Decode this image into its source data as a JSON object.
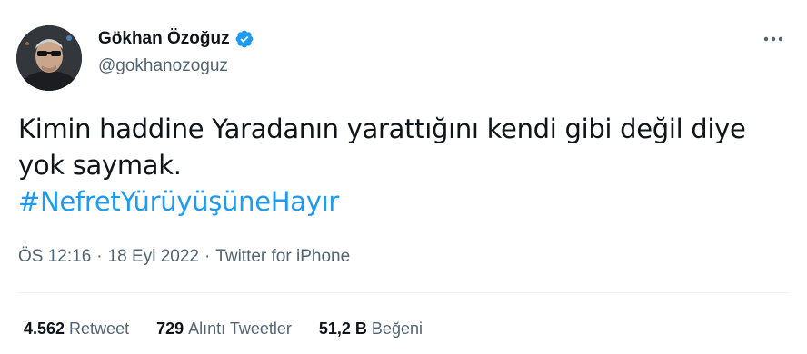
{
  "user": {
    "display_name": "Gökhan Özoğuz",
    "handle": "@gokhanozoguz",
    "verified": true,
    "avatar_icon": "profile-photo"
  },
  "tweet": {
    "lines": [
      "Kimin haddine Yaradanın yarattığını kendi gibi değil diye",
      "yok saymak."
    ],
    "hashtag": "#NefretYürüyüşüneHayır"
  },
  "meta": {
    "time": "ÖS 12:16",
    "separator": "·",
    "date": "18 Eyl 2022",
    "source": "Twitter for iPhone"
  },
  "stats": [
    {
      "count": "4.562",
      "label": "Retweet"
    },
    {
      "count": "729",
      "label": "Alıntı Tweetler"
    },
    {
      "count": "51,2 B",
      "label": "Beğeni"
    }
  ],
  "colors": {
    "accent": "#1d9bf0",
    "text_primary": "#0f1419",
    "text_secondary": "#536471",
    "divider": "#eff3f4"
  },
  "icons": {
    "verified": "verified-badge-icon",
    "more": "more-dots-icon"
  }
}
